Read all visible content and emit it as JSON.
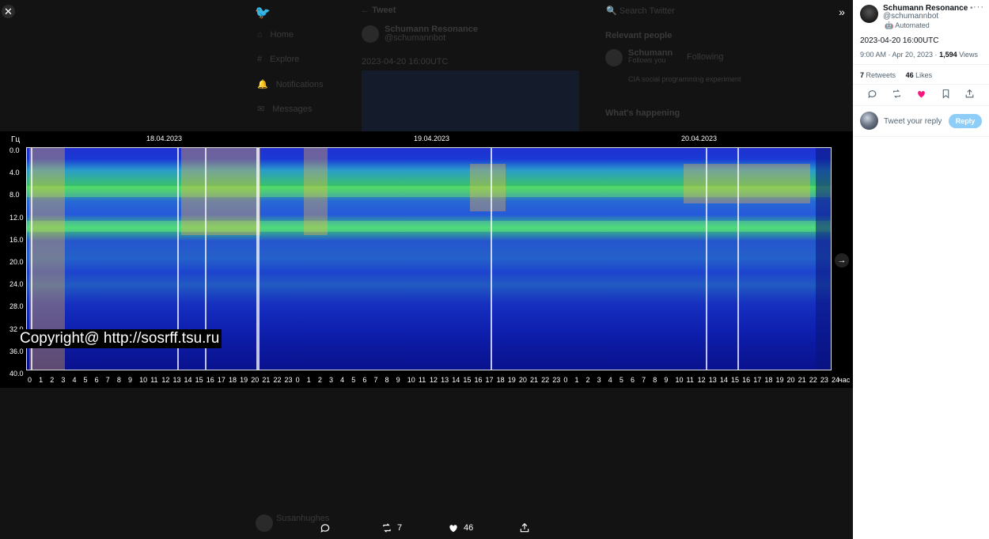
{
  "background": {
    "nav": [
      "Home",
      "Explore",
      "Notifications",
      "Messages"
    ],
    "header_title": "Tweet",
    "search_placeholder": "Search Twitter",
    "relevant_people_title": "Relevant people",
    "whats_happening_title": "What's happening",
    "tweet_author": "Schumann Resonance",
    "tweet_handle": "@schumannbot",
    "tweet_text": "2023-04-20 16:00UTC",
    "person_name": "Schumann",
    "person_follows": "Follows you",
    "person_following": "Following",
    "person_bio": "CIA social programming experiment",
    "bottom_user": "Susanhughes"
  },
  "spectrogram": {
    "y_unit": "Гц",
    "y_ticks": [
      "0.0",
      "4.0",
      "8.0",
      "12.0",
      "16.0",
      "20.0",
      "24.0",
      "28.0",
      "32.0",
      "36.0",
      "40.0"
    ],
    "dates": [
      "18.04.2023",
      "19.04.2023",
      "20.04.2023"
    ],
    "x_ticks": [
      "0",
      "1",
      "2",
      "3",
      "4",
      "5",
      "6",
      "7",
      "8",
      "9",
      "10",
      "11",
      "12",
      "13",
      "14",
      "15",
      "16",
      "17",
      "18",
      "19",
      "20",
      "21",
      "22",
      "23",
      "0",
      "1",
      "2",
      "3",
      "4",
      "5",
      "6",
      "7",
      "8",
      "9",
      "10",
      "11",
      "12",
      "13",
      "14",
      "15",
      "16",
      "17",
      "18",
      "19",
      "20",
      "21",
      "22",
      "23",
      "0",
      "1",
      "2",
      "3",
      "4",
      "5",
      "6",
      "7",
      "8",
      "9",
      "10",
      "11",
      "12",
      "13",
      "14",
      "15",
      "16",
      "17",
      "18",
      "19",
      "20",
      "21",
      "22",
      "23",
      "24"
    ],
    "x_unit": "час",
    "copyright": "Copyright@ http://sosrff.tsu.ru"
  },
  "actionbar": {
    "retweets": "7",
    "likes": "46"
  },
  "panel": {
    "name": "Schumann Resonance",
    "handle": "@schumannbot",
    "automated": "Automated",
    "text": "2023-04-20 16:00UTC",
    "time": "9:00 AM · Apr 20, 2023 · ",
    "views_count": "1,594",
    "views_label": " Views",
    "retweets_count": "7",
    "retweets_label": " Retweets",
    "likes_count": "46",
    "likes_label": " Likes",
    "reply_placeholder": "Tweet your reply",
    "reply_button": "Reply"
  },
  "colors": {
    "like_active": "#f91880",
    "reply_button": "#8ecdf8"
  }
}
